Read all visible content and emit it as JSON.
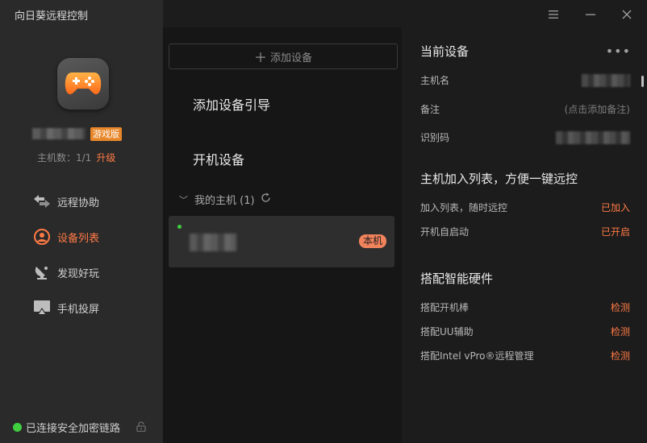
{
  "app": {
    "title": "向日葵远程控制"
  },
  "profile": {
    "badge": "游戏版",
    "host_count": "主机数：1/1",
    "upgrade": "升级"
  },
  "nav": {
    "items": [
      {
        "label": "远程协助",
        "icon": "remote-assist-icon",
        "active": false
      },
      {
        "label": "设备列表",
        "icon": "device-list-icon",
        "active": true
      },
      {
        "label": "发现好玩",
        "icon": "discover-icon",
        "active": false
      },
      {
        "label": "手机投屏",
        "icon": "screen-cast-icon",
        "active": false
      }
    ]
  },
  "footer": {
    "status": "已连接安全加密链路"
  },
  "middle": {
    "add_device": "添加设备",
    "guide_link": "添加设备引导",
    "boot_link": "开机设备",
    "group_label": "我的主机 (1)",
    "device_badge": "本机"
  },
  "right": {
    "current_title": "当前设备",
    "more": "•••",
    "host_name_label": "主机名",
    "remark_label": "备注",
    "remark_placeholder": "(点击添加备注)",
    "id_label": "识别码",
    "list_title": "主机加入列表，方便一键远控",
    "join_label": "加入列表，随时远控",
    "join_value": "已加入",
    "autostart_label": "开机自启动",
    "autostart_value": "已开启",
    "hw_title": "搭配智能硬件",
    "hw_items": [
      {
        "label": "搭配开机棒",
        "action": "检测"
      },
      {
        "label": "搭配UU辅助",
        "action": "检测"
      },
      {
        "label": "搭配Intel vPro®远程管理",
        "action": "检测"
      }
    ]
  },
  "colors": {
    "accent": "#ff7a45",
    "badge": "#e8872a",
    "online": "#3fcf3f"
  }
}
